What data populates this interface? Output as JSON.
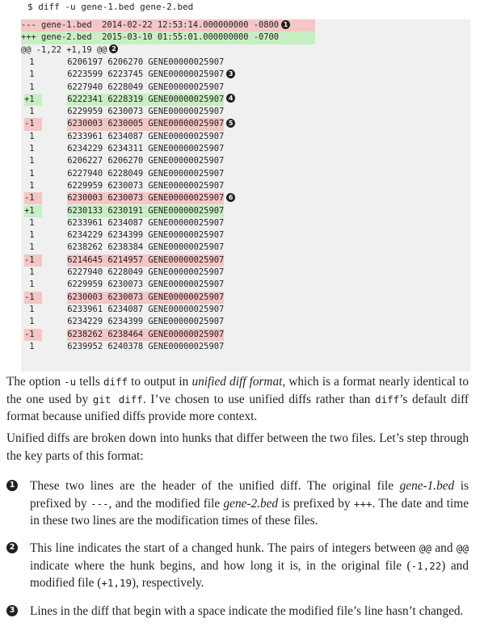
{
  "command": "$ diff -u gene-1.bed gene-2.bed",
  "header": {
    "old": "--- gene-1.bed  2014-02-22 12:53:14.000000000 -0800",
    "new": "+++ gene-2.bed  2015-03-10 01:55:01.000000000 -0700",
    "hunk": "@@ -1,22 +1,19 @@"
  },
  "callouts": [
    "1",
    "2",
    "3",
    "4",
    "5",
    "6"
  ],
  "diff_lines": [
    {
      "p": " 1",
      "t": "6206197 6206270 GENE00000025907",
      "k": "ctx",
      "c": ""
    },
    {
      "p": " 1",
      "t": "6223599 6223745 GENE00000025907",
      "k": "ctx",
      "c": "3"
    },
    {
      "p": " 1",
      "t": "6227940 6228049 GENE00000025907",
      "k": "ctx",
      "c": ""
    },
    {
      "p": "+1",
      "t": "6222341 6228319 GENE00000025907",
      "k": "add",
      "c": "4"
    },
    {
      "p": " 1",
      "t": "6229959 6230073 GENE00000025907",
      "k": "ctx",
      "c": ""
    },
    {
      "p": "-1",
      "t": "6230003 6230005 GENE00000025907",
      "k": "del",
      "c": "5"
    },
    {
      "p": " 1",
      "t": "6233961 6234087 GENE00000025907",
      "k": "ctx",
      "c": ""
    },
    {
      "p": " 1",
      "t": "6234229 6234311 GENE00000025907",
      "k": "ctx",
      "c": ""
    },
    {
      "p": " 1",
      "t": "6206227 6206270 GENE00000025907",
      "k": "ctx",
      "c": ""
    },
    {
      "p": " 1",
      "t": "6227940 6228049 GENE00000025907",
      "k": "ctx",
      "c": ""
    },
    {
      "p": " 1",
      "t": "6229959 6230073 GENE00000025907",
      "k": "ctx",
      "c": ""
    },
    {
      "p": "-1",
      "t": "6230003 6230073 GENE00000025907",
      "k": "del",
      "c": "6"
    },
    {
      "p": "+1",
      "t": "6230133 6230191 GENE00000025907",
      "k": "add",
      "c": ""
    },
    {
      "p": " 1",
      "t": "6233961 6234087 GENE00000025907",
      "k": "ctx",
      "c": ""
    },
    {
      "p": " 1",
      "t": "6234229 6234399 GENE00000025907",
      "k": "ctx",
      "c": ""
    },
    {
      "p": " 1",
      "t": "6238262 6238384 GENE00000025907",
      "k": "ctx",
      "c": ""
    },
    {
      "p": "-1",
      "t": "6214645 6214957 GENE00000025907",
      "k": "del",
      "c": ""
    },
    {
      "p": " 1",
      "t": "6227940 6228049 GENE00000025907",
      "k": "ctx",
      "c": ""
    },
    {
      "p": " 1",
      "t": "6229959 6230073 GENE00000025907",
      "k": "ctx",
      "c": ""
    },
    {
      "p": "-1",
      "t": "6230003 6230073 GENE00000025907",
      "k": "del",
      "c": ""
    },
    {
      "p": " 1",
      "t": "6233961 6234087 GENE00000025907",
      "k": "ctx",
      "c": ""
    },
    {
      "p": " 1",
      "t": "6234229 6234399 GENE00000025907",
      "k": "ctx",
      "c": ""
    },
    {
      "p": "-1",
      "t": "6238262 6238464 GENE00000025907",
      "k": "del",
      "c": ""
    },
    {
      "p": " 1",
      "t": "6239952 6240378 GENE00000025907",
      "k": "ctx",
      "c": ""
    }
  ],
  "para1": {
    "a": "The option ",
    "b": "-u",
    "c": " tells ",
    "d": "diff",
    "e": " to output in ",
    "f": "unified diff format",
    "g": ", which is a format nearly identical to the one used by ",
    "h": "git diff",
    "i": ". I’ve chosen to use unified diffs rather than ",
    "j": "diff",
    "k": "’s default diff format because unified diffs provide more context."
  },
  "para2": "Unified diffs are broken down into hunks that differ between the two files. Let’s step through the key parts of this format:",
  "note1": {
    "a": "These two lines are the header of the unified diff. The original file ",
    "b": "gene-1.bed",
    "c": " is prefixed by ",
    "d": "---",
    "e": ", and the modified file ",
    "f": "gene-2.bed",
    "g": " is prefixed by ",
    "h": "+++",
    "i": ". The date and time in these two lines are the modification times of these files."
  },
  "note2": {
    "a": "This line indicates the start of a changed hunk. The pairs of integers between ",
    "b": "@@",
    "c": " and ",
    "d": "@@",
    "e": " indicate where the hunk begins, and how long it is, in the original file (",
    "f": "-1,22",
    "g": ") and modified file (",
    "h": "+1,19",
    "i": "), respectively."
  },
  "note3": "Lines in the diff that begin with a space indicate the modified file’s line hasn’t changed."
}
